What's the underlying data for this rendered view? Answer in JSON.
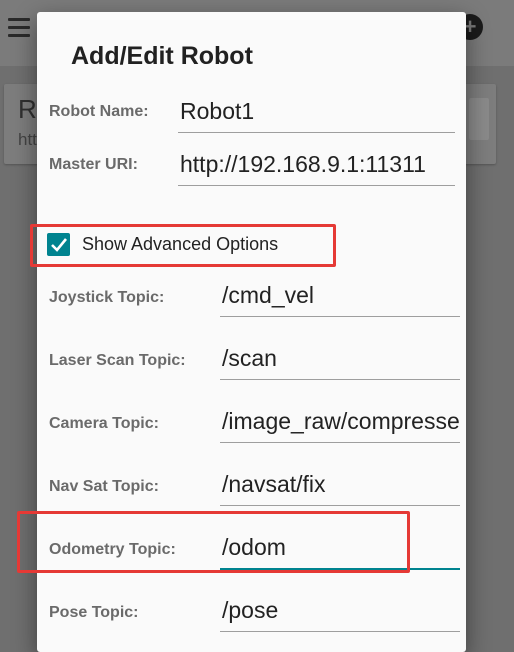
{
  "background": {
    "card_title_partial": "R",
    "card_subtitle_partial": "htt"
  },
  "dialog": {
    "title": "Add/Edit Robot",
    "robot_name": {
      "label": "Robot Name:",
      "value": "Robot1"
    },
    "master_uri": {
      "label": "Master URI:",
      "value": "http://192.168.9.1:11311"
    },
    "advanced": {
      "label": "Show Advanced Options",
      "checked": true
    },
    "fields": {
      "joystick": {
        "label": "Joystick Topic:",
        "value": "/cmd_vel"
      },
      "laser_scan": {
        "label": "Laser Scan Topic:",
        "value": "/scan"
      },
      "camera": {
        "label": "Camera Topic:",
        "value": "/image_raw/compressed"
      },
      "nav_sat": {
        "label": "Nav Sat Topic:",
        "value": "/navsat/fix"
      },
      "odometry": {
        "label": "Odometry Topic:",
        "value": "/odom"
      },
      "pose": {
        "label": "Pose Topic:",
        "value": "/pose"
      }
    }
  },
  "colors": {
    "accent": "#00838f",
    "highlight": "#e53935",
    "scrim": "#6f6f6f"
  },
  "icons": {
    "menu": "menu-icon",
    "add": "add-icon",
    "check": "checkmark-icon"
  }
}
